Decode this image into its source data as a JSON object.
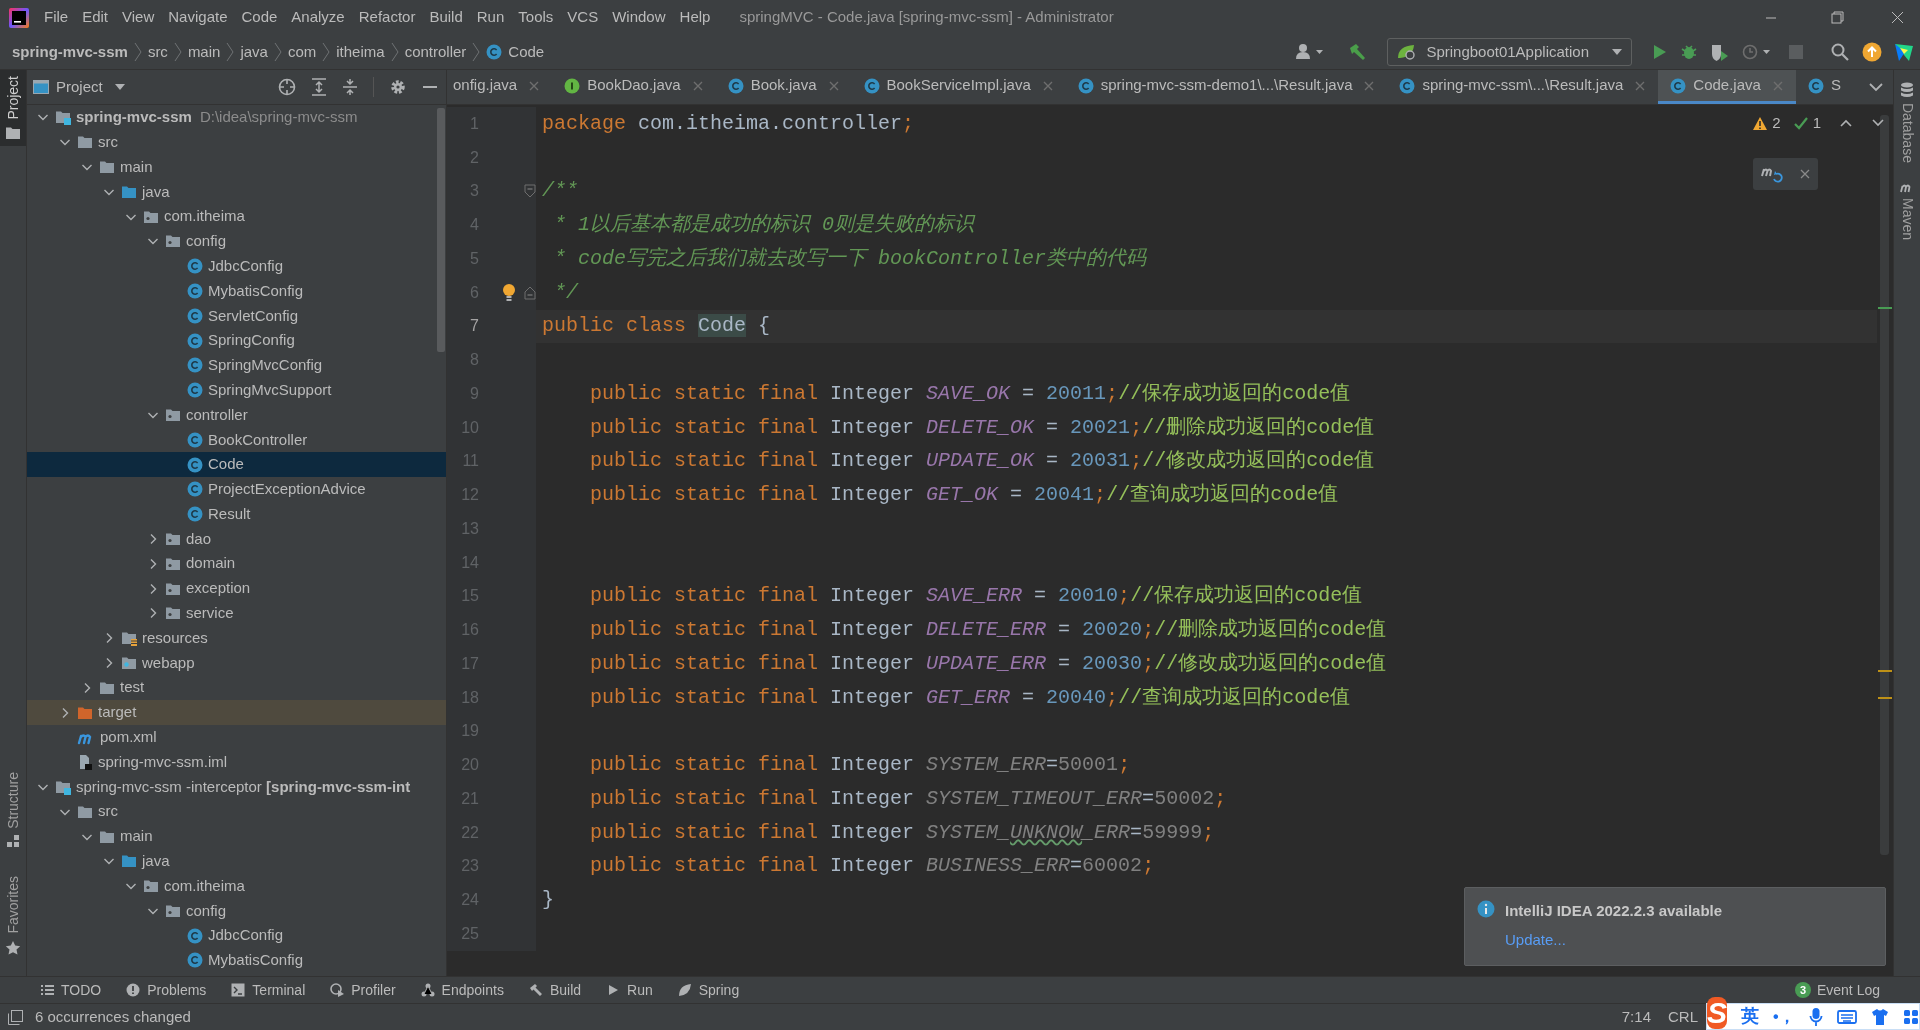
{
  "title_bar": {
    "menus": [
      "File",
      "Edit",
      "View",
      "Navigate",
      "Code",
      "Analyze",
      "Refactor",
      "Build",
      "Run",
      "Tools",
      "VCS",
      "Window",
      "Help"
    ],
    "title": "springMVC - Code.java [spring-mvc-ssm] - Administrator"
  },
  "nav_bar": {
    "breadcrumbs": [
      {
        "label": "spring-mvc-ssm",
        "kind": "module"
      },
      {
        "label": "src",
        "kind": "folder"
      },
      {
        "label": "main",
        "kind": "folder"
      },
      {
        "label": "java",
        "kind": "folder"
      },
      {
        "label": "com",
        "kind": "folder"
      },
      {
        "label": "itheima",
        "kind": "folder"
      },
      {
        "label": "controller",
        "kind": "folder"
      },
      {
        "label": "Code",
        "kind": "class"
      }
    ],
    "run_config": "Springboot01Application"
  },
  "left_strip": [
    {
      "label": "Project",
      "kind": "project",
      "selected": true
    },
    {
      "label": "Structure",
      "kind": "structure",
      "selected": false
    },
    {
      "label": "Favorites",
      "kind": "favorites",
      "selected": false
    }
  ],
  "project_panel": {
    "title": "Project",
    "tree": [
      {
        "label": "spring-mvc-ssm",
        "path": "D:\\idea\\spring-mvc-ssm",
        "kind": "module",
        "bold": true,
        "expanded": true,
        "selected": false,
        "children": [
          {
            "label": "src",
            "kind": "folder",
            "expanded": true,
            "selected": false,
            "children": [
              {
                "label": "main",
                "kind": "folder",
                "expanded": true,
                "selected": false,
                "children": [
                  {
                    "label": "java",
                    "kind": "source",
                    "expanded": true,
                    "selected": false,
                    "children": [
                      {
                        "label": "com.itheima",
                        "kind": "package",
                        "expanded": true,
                        "selected": false,
                        "children": [
                          {
                            "label": "config",
                            "kind": "package",
                            "expanded": true,
                            "selected": false,
                            "children": [
                              {
                                "label": "JdbcConfig",
                                "kind": "class",
                                "selected": false
                              },
                              {
                                "label": "MybatisConfig",
                                "kind": "class",
                                "selected": false
                              },
                              {
                                "label": "ServletConfig",
                                "kind": "class",
                                "selected": false
                              },
                              {
                                "label": "SpringConfig",
                                "kind": "class",
                                "selected": false
                              },
                              {
                                "label": "SpringMvcConfig",
                                "kind": "class",
                                "selected": false
                              },
                              {
                                "label": "SpringMvcSupport",
                                "kind": "class",
                                "selected": false
                              }
                            ]
                          },
                          {
                            "label": "controller",
                            "kind": "package",
                            "expanded": true,
                            "selected": false,
                            "children": [
                              {
                                "label": "BookController",
                                "kind": "class",
                                "selected": false
                              },
                              {
                                "label": "Code",
                                "kind": "class",
                                "selected": true
                              },
                              {
                                "label": "ProjectExceptionAdvice",
                                "kind": "class",
                                "selected": false
                              },
                              {
                                "label": "Result",
                                "kind": "class",
                                "selected": false
                              }
                            ]
                          },
                          {
                            "label": "dao",
                            "kind": "package",
                            "expanded": false,
                            "selected": false
                          },
                          {
                            "label": "domain",
                            "kind": "package",
                            "expanded": false,
                            "selected": false
                          },
                          {
                            "label": "exception",
                            "kind": "package",
                            "expanded": false,
                            "selected": false
                          },
                          {
                            "label": "service",
                            "kind": "package",
                            "expanded": false,
                            "selected": false
                          }
                        ]
                      }
                    ]
                  },
                  {
                    "label": "resources",
                    "kind": "resources",
                    "expanded": false,
                    "selected": false
                  },
                  {
                    "label": "webapp",
                    "kind": "webapp",
                    "expanded": false,
                    "selected": false
                  }
                ]
              },
              {
                "label": "test",
                "kind": "folder",
                "expanded": false,
                "selected": false
              }
            ]
          },
          {
            "label": "target",
            "kind": "excluded",
            "expanded": false,
            "selected": false
          },
          {
            "label": "pom.xml",
            "kind": "maven",
            "selected": false
          },
          {
            "label": "spring-mvc-ssm.iml",
            "kind": "iml",
            "selected": false
          }
        ]
      },
      {
        "label": "spring-mvc-ssm -interceptor **[spring-mvc-ssm-int**",
        "kind": "module",
        "bold": false,
        "expanded": true,
        "selected": false,
        "children": [
          {
            "label": "src",
            "kind": "folder",
            "expanded": true,
            "selected": false,
            "children": [
              {
                "label": "main",
                "kind": "folder",
                "expanded": true,
                "selected": false,
                "children": [
                  {
                    "label": "java",
                    "kind": "source",
                    "expanded": true,
                    "selected": false,
                    "children": [
                      {
                        "label": "com.itheima",
                        "kind": "package",
                        "expanded": true,
                        "selected": false,
                        "children": [
                          {
                            "label": "config",
                            "kind": "package",
                            "expanded": true,
                            "selected": false,
                            "children": [
                              {
                                "label": "JdbcConfig",
                                "kind": "class",
                                "selected": false
                              },
                              {
                                "label": "MybatisConfig",
                                "kind": "class",
                                "selected": false
                              }
                            ]
                          }
                        ]
                      }
                    ]
                  }
                ]
              }
            ]
          }
        ]
      }
    ]
  },
  "editor": {
    "tabs": [
      {
        "label": "onfig.java",
        "kind": "none",
        "closable": true,
        "selected": false
      },
      {
        "label": "BookDao.java",
        "kind": "interface",
        "closable": true,
        "selected": false
      },
      {
        "label": "Book.java",
        "kind": "class",
        "closable": true,
        "selected": false
      },
      {
        "label": "BookServiceImpl.java",
        "kind": "class",
        "closable": true,
        "selected": false
      },
      {
        "label": "spring-mvc-ssm-demo1\\...\\Result.java",
        "kind": "class",
        "closable": true,
        "selected": false
      },
      {
        "label": "spring-mvc-ssm\\...\\Result.java",
        "kind": "class",
        "closable": true,
        "selected": false
      },
      {
        "label": "Code.java",
        "kind": "class",
        "closable": true,
        "selected": true
      },
      {
        "label": "S",
        "kind": "class",
        "closable": false,
        "selected": false
      }
    ],
    "inspections": {
      "warnings": "2",
      "passed": "1"
    },
    "lines": [
      {
        "number": "1",
        "current": false,
        "fold_start": false,
        "fold_end": false,
        "bulb": false,
        "tokens": [
          {
            "t": "package",
            "kind": "kw"
          },
          {
            "t": " com.itheima.controller",
            "kind": "text"
          },
          {
            "t": ";",
            "kind": "punct"
          }
        ]
      },
      {
        "number": "2",
        "current": false,
        "fold_start": false,
        "fold_end": false,
        "bulb": false
      },
      {
        "number": "3",
        "current": false,
        "fold_start": true,
        "fold_end": false,
        "bulb": false,
        "tokens": [
          {
            "t": "/**",
            "kind": "doc"
          }
        ]
      },
      {
        "number": "4",
        "current": false,
        "fold_start": false,
        "fold_end": false,
        "bulb": false,
        "tokens": [
          {
            "t": " * 1以后基本都是成功的标识 0则是失败的标识",
            "kind": "doc"
          }
        ]
      },
      {
        "number": "5",
        "current": false,
        "fold_start": false,
        "fold_end": false,
        "bulb": false,
        "tokens": [
          {
            "t": " * code写完之后我们就去改写一下 bookController类中的代码",
            "kind": "doc"
          }
        ]
      },
      {
        "number": "6",
        "current": false,
        "fold_start": false,
        "fold_end": true,
        "bulb": true,
        "tokens": [
          {
            "t": " */",
            "kind": "doc"
          }
        ]
      },
      {
        "number": "7",
        "current": true,
        "tokens": [
          {
            "t": "public class ",
            "kind": "kw"
          },
          {
            "t": "Code",
            "kind": "hl"
          },
          {
            "t": " {",
            "kind": "text"
          }
        ]
      },
      {
        "number": "8",
        "current": false
      },
      {
        "number": "9",
        "current": false,
        "tokens": [
          {
            "t": "    public static final ",
            "kind": "kw"
          },
          {
            "t": "Integer ",
            "kind": "text"
          },
          {
            "t": "SAVE_OK",
            "kind": "const"
          },
          {
            "t": " = ",
            "kind": "text"
          },
          {
            "t": "20011",
            "kind": "num"
          },
          {
            "t": ";",
            "kind": "punct"
          },
          {
            "t": "//保存成功返回的code值",
            "kind": "comment"
          }
        ]
      },
      {
        "number": "10",
        "current": false,
        "tokens": [
          {
            "t": "    public static final ",
            "kind": "kw"
          },
          {
            "t": "Integer ",
            "kind": "text"
          },
          {
            "t": "DELETE_OK",
            "kind": "const"
          },
          {
            "t": " = ",
            "kind": "text"
          },
          {
            "t": "20021",
            "kind": "num"
          },
          {
            "t": ";",
            "kind": "punct"
          },
          {
            "t": "//删除成功返回的code值",
            "kind": "comment"
          }
        ]
      },
      {
        "number": "11",
        "current": false,
        "tokens": [
          {
            "t": "    public static final ",
            "kind": "kw"
          },
          {
            "t": "Integer ",
            "kind": "text"
          },
          {
            "t": "UPDATE_OK",
            "kind": "const"
          },
          {
            "t": " = ",
            "kind": "text"
          },
          {
            "t": "20031",
            "kind": "num"
          },
          {
            "t": ";",
            "kind": "punct"
          },
          {
            "t": "//修改成功返回的code值",
            "kind": "comment"
          }
        ]
      },
      {
        "number": "12",
        "current": false,
        "tokens": [
          {
            "t": "    public static final ",
            "kind": "kw"
          },
          {
            "t": "Integer ",
            "kind": "text"
          },
          {
            "t": "GET_OK",
            "kind": "const"
          },
          {
            "t": " = ",
            "kind": "text"
          },
          {
            "t": "20041",
            "kind": "num"
          },
          {
            "t": ";",
            "kind": "punct"
          },
          {
            "t": "//查询成功返回的code值",
            "kind": "comment"
          }
        ]
      },
      {
        "number": "13",
        "current": false
      },
      {
        "number": "14",
        "current": false
      },
      {
        "number": "15",
        "current": false,
        "tokens": [
          {
            "t": "    public static final ",
            "kind": "kw"
          },
          {
            "t": "Integer ",
            "kind": "text"
          },
          {
            "t": "SAVE_ERR",
            "kind": "const"
          },
          {
            "t": " = ",
            "kind": "text"
          },
          {
            "t": "20010",
            "kind": "num"
          },
          {
            "t": ";",
            "kind": "punct"
          },
          {
            "t": "//保存成功返回的code值",
            "kind": "comment"
          }
        ]
      },
      {
        "number": "16",
        "current": false,
        "tokens": [
          {
            "t": "    public static final ",
            "kind": "kw"
          },
          {
            "t": "Integer ",
            "kind": "text"
          },
          {
            "t": "DELETE_ERR",
            "kind": "const"
          },
          {
            "t": " = ",
            "kind": "text"
          },
          {
            "t": "20020",
            "kind": "num"
          },
          {
            "t": ";",
            "kind": "punct"
          },
          {
            "t": "//删除成功返回的code值",
            "kind": "comment"
          }
        ]
      },
      {
        "number": "17",
        "current": false,
        "tokens": [
          {
            "t": "    public static final ",
            "kind": "kw"
          },
          {
            "t": "Integer ",
            "kind": "text"
          },
          {
            "t": "UPDATE_ERR",
            "kind": "const"
          },
          {
            "t": " = ",
            "kind": "text"
          },
          {
            "t": "20030",
            "kind": "num"
          },
          {
            "t": ";",
            "kind": "punct"
          },
          {
            "t": "//修改成功返回的code值",
            "kind": "comment"
          }
        ]
      },
      {
        "number": "18",
        "current": false,
        "tokens": [
          {
            "t": "    public static final ",
            "kind": "kw"
          },
          {
            "t": "Integer ",
            "kind": "text"
          },
          {
            "t": "GET_ERR",
            "kind": "const"
          },
          {
            "t": " = ",
            "kind": "text"
          },
          {
            "t": "20040",
            "kind": "num"
          },
          {
            "t": ";",
            "kind": "punct"
          },
          {
            "t": "//查询成功返回的code值",
            "kind": "comment"
          }
        ]
      },
      {
        "number": "19",
        "current": false
      },
      {
        "number": "20",
        "current": false,
        "tokens": [
          {
            "t": "    public static final ",
            "kind": "kw"
          },
          {
            "t": "Integer ",
            "kind": "text"
          },
          {
            "t": "SYSTEM_ERR",
            "kind": "unused"
          },
          {
            "t": "=",
            "kind": "text"
          },
          {
            "t": "50001",
            "kind": "unused_num"
          },
          {
            "t": ";",
            "kind": "punct"
          }
        ]
      },
      {
        "number": "21",
        "current": false,
        "tokens": [
          {
            "t": "    public static final ",
            "kind": "kw"
          },
          {
            "t": "Integer ",
            "kind": "text"
          },
          {
            "t": "SYSTEM_TIMEOUT_ERR",
            "kind": "unused"
          },
          {
            "t": "=",
            "kind": "text"
          },
          {
            "t": "50002",
            "kind": "unused_num"
          },
          {
            "t": ";",
            "kind": "punct"
          }
        ]
      },
      {
        "number": "22",
        "current": false,
        "tokens": [
          {
            "t": "    public static final ",
            "kind": "kw"
          },
          {
            "t": "Integer ",
            "kind": "text"
          },
          {
            "t": "SYSTEM_",
            "kind": "unused"
          },
          {
            "t": "UNKNOW",
            "kind": "typo"
          },
          {
            "t": "_ERR",
            "kind": "unused"
          },
          {
            "t": "=",
            "kind": "text"
          },
          {
            "t": "59999",
            "kind": "unused_num"
          },
          {
            "t": ";",
            "kind": "punct"
          }
        ]
      },
      {
        "number": "23",
        "current": false,
        "tokens": [
          {
            "t": "    public static final ",
            "kind": "kw"
          },
          {
            "t": "Integer ",
            "kind": "text"
          },
          {
            "t": "BUSINESS_ERR",
            "kind": "unused"
          },
          {
            "t": "=",
            "kind": "text"
          },
          {
            "t": "60002",
            "kind": "unused_num"
          },
          {
            "t": ";",
            "kind": "punct"
          }
        ]
      },
      {
        "number": "24",
        "current": false,
        "tokens": [
          {
            "t": "}",
            "kind": "text"
          }
        ]
      },
      {
        "number": "25",
        "current": false
      }
    ]
  },
  "right_strip": [
    {
      "label": "Database",
      "kind": "database"
    },
    {
      "label": "Maven",
      "kind": "maven"
    }
  ],
  "notification": {
    "title": "IntelliJ IDEA 2022.2.3 available",
    "link": "Update..."
  },
  "tool_bar": {
    "items": [
      {
        "label": "TODO",
        "kind": "todo"
      },
      {
        "label": "Problems",
        "kind": "problems"
      },
      {
        "label": "Terminal",
        "kind": "terminal"
      },
      {
        "label": "Profiler",
        "kind": "profiler"
      },
      {
        "label": "Endpoints",
        "kind": "endpoints"
      },
      {
        "label": "Build",
        "kind": "build"
      },
      {
        "label": "Run",
        "kind": "run"
      },
      {
        "label": "Spring",
        "kind": "spring"
      }
    ],
    "event_log": {
      "label": "Event Log",
      "badge": "3"
    }
  },
  "status_bar": {
    "message": "6 occurrences changed",
    "position": "7:14",
    "line_separator": "CRL"
  },
  "ime_bar": {
    "logo": "S",
    "mode": "英",
    "punctuation": "•，"
  }
}
